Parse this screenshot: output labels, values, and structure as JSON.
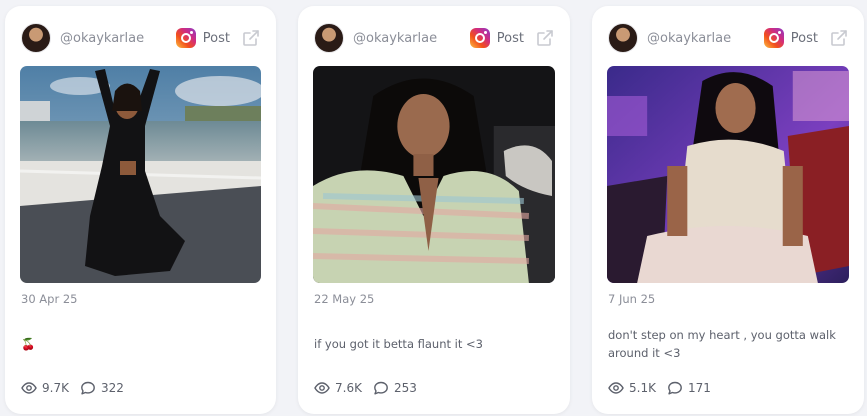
{
  "posts": [
    {
      "username": "@okaykarlae",
      "platform_icon": "instagram-icon",
      "post_label": "Post",
      "date": "30 Apr 25",
      "caption": "🍒",
      "views": "9.7K",
      "comments": "322",
      "accent": "#1b5a73"
    },
    {
      "username": "@okaykarlae",
      "platform_icon": "instagram-icon",
      "post_label": "Post",
      "date": "22 May 25",
      "caption": "if you got it betta flaunt it <3",
      "views": "7.6K",
      "comments": "253",
      "accent": "#1a1a1a"
    },
    {
      "username": "@okaykarlae",
      "platform_icon": "instagram-icon",
      "post_label": "Post",
      "date": "7 Jun 25",
      "caption": "don't step on my heart , you gotta walk around it <3",
      "views": "5.1K",
      "comments": "171",
      "accent": "#4b2b8f"
    }
  ]
}
